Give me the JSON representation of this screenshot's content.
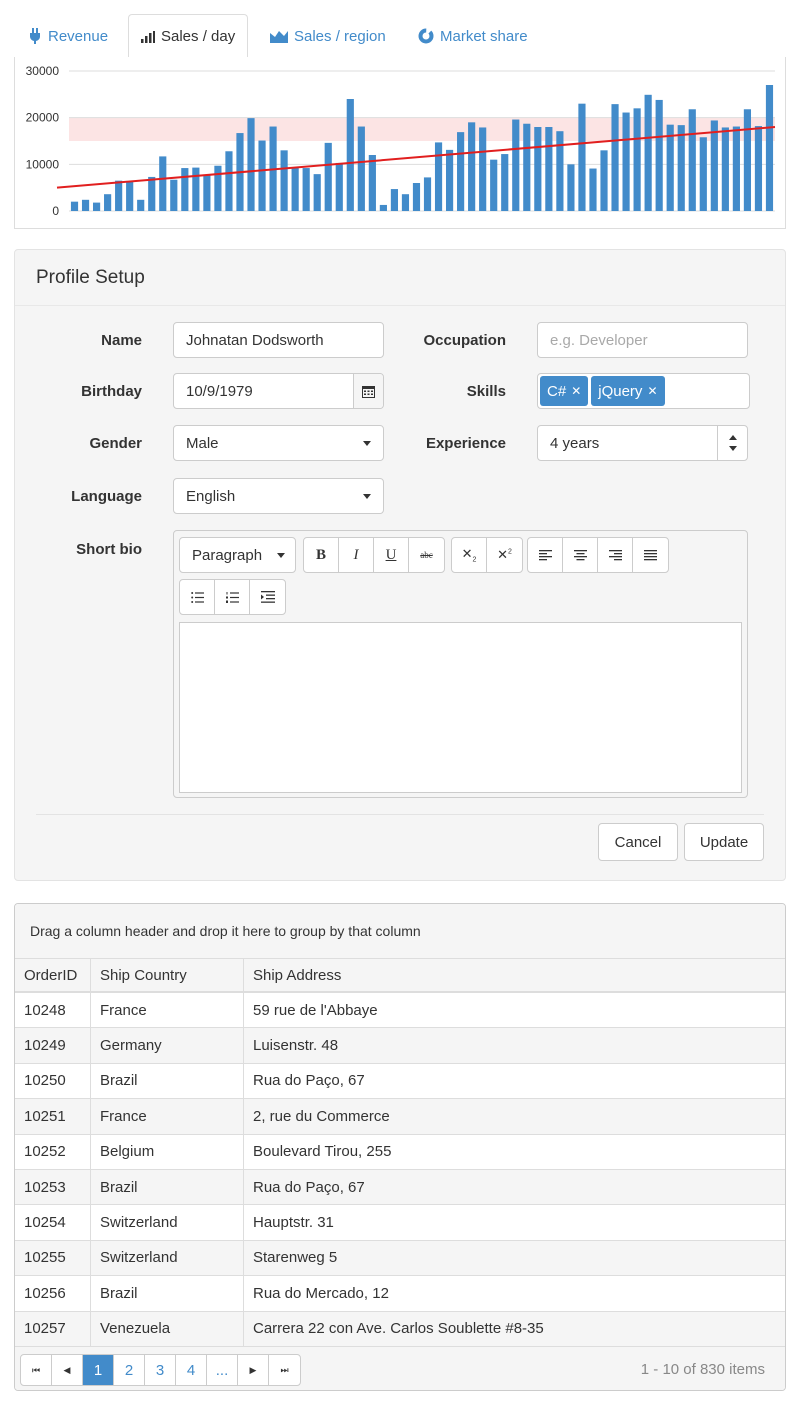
{
  "tabs": [
    {
      "label": "Revenue",
      "icon": "plug-icon"
    },
    {
      "label": "Sales / day",
      "icon": "bar-chart-icon",
      "active": true
    },
    {
      "label": "Sales / region",
      "icon": "area-chart-icon"
    },
    {
      "label": "Market share",
      "icon": "donut-chart-icon"
    }
  ],
  "chart_data": {
    "type": "bar",
    "yticks": [
      "30000",
      "20000",
      "10000",
      "0"
    ],
    "ylim": [
      0,
      30000
    ],
    "grid": true,
    "band": [
      15000,
      20000
    ],
    "series": [
      {
        "type": "bar",
        "color": "#428bca",
        "values": [
          2000,
          2400,
          1800,
          3600,
          6500,
          6300,
          2400,
          7300,
          11700,
          6700,
          9200,
          9300,
          7800,
          9700,
          12800,
          16700,
          19900,
          15100,
          18100,
          13000,
          9300,
          9200,
          7900,
          14600,
          10300,
          24000,
          18100,
          12000,
          1300,
          4700,
          3600,
          6000,
          7200,
          14700,
          13100,
          16900,
          19000,
          17900,
          11000,
          12200,
          19600,
          18700,
          18000,
          18000,
          17100,
          10000,
          23000,
          9100,
          13000,
          22900,
          21100,
          22000,
          24900,
          23800,
          18500,
          18400,
          21800,
          15800,
          19400,
          17900,
          18100,
          21800,
          18200,
          27000
        ]
      },
      {
        "type": "line",
        "color": "#e11f1f",
        "points": [
          [
            0,
            5000
          ],
          [
            63,
            18000
          ]
        ]
      }
    ]
  },
  "profile": {
    "title": "Profile Setup",
    "name": {
      "label": "Name",
      "value": "Johnatan Dodsworth"
    },
    "occupation": {
      "label": "Occupation",
      "placeholder": "e.g. Developer"
    },
    "birthday": {
      "label": "Birthday",
      "value": "10/9/1979"
    },
    "skills": {
      "label": "Skills",
      "tags": [
        "C#",
        "jQuery"
      ]
    },
    "gender": {
      "label": "Gender",
      "value": "Male"
    },
    "experience": {
      "label": "Experience",
      "value": "4 years"
    },
    "language": {
      "label": "Language",
      "value": "English"
    },
    "bio": {
      "label": "Short bio",
      "format": "Paragraph"
    },
    "cancel": "Cancel",
    "update": "Update"
  },
  "grid": {
    "group_hint": "Drag a column header and drop it here to group by that column",
    "columns": [
      "OrderID",
      "Ship Country",
      "Ship Address"
    ],
    "rows": [
      [
        "10248",
        "France",
        "59 rue de l'Abbaye"
      ],
      [
        "10249",
        "Germany",
        "Luisenstr. 48"
      ],
      [
        "10250",
        "Brazil",
        "Rua do Paço, 67"
      ],
      [
        "10251",
        "France",
        "2, rue du Commerce"
      ],
      [
        "10252",
        "Belgium",
        "Boulevard Tirou, 255"
      ],
      [
        "10253",
        "Brazil",
        "Rua do Paço, 67"
      ],
      [
        "10254",
        "Switzerland",
        "Hauptstr. 31"
      ],
      [
        "10255",
        "Switzerland",
        "Starenweg 5"
      ],
      [
        "10256",
        "Brazil",
        "Rua do Mercado, 12"
      ],
      [
        "10257",
        "Venezuela",
        "Carrera 22 con Ave. Carlos Soublette #8-35"
      ]
    ],
    "pager": {
      "pages": [
        "1",
        "2",
        "3",
        "4",
        "..."
      ],
      "current": "1",
      "info": "1 - 10 of 830 items"
    }
  }
}
